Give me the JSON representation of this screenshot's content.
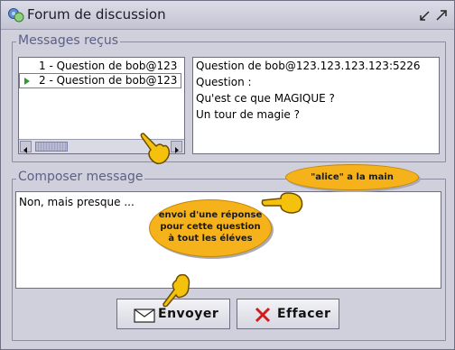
{
  "window": {
    "title": "Forum de discussion"
  },
  "received": {
    "legend": "Messages reçus",
    "items": [
      {
        "label": "1 - Question de bob@123"
      },
      {
        "label": "2 - Question de bob@123"
      }
    ],
    "message_lines": [
      "Question de bob@123.123.123.123:5226",
      "Question :",
      "Qu'est ce que MAGIQUE ?",
      "Un tour de magie ?"
    ]
  },
  "compose": {
    "legend": "Composer message",
    "text": "Non, mais presque ..."
  },
  "buttons": {
    "send_label": "Envoyer",
    "clear_label": "Effacer"
  },
  "annotations": {
    "alice": "\"alice\" a la main",
    "send_line1": "envoi d'une réponse",
    "send_line2": "pour cette question",
    "send_line3": "à tout les éléves"
  },
  "colors": {
    "accent": "#5d6086",
    "bubble": "#f6b21a",
    "selection_arrow": "#2d9a2d",
    "clear_x": "#d11c1c"
  }
}
